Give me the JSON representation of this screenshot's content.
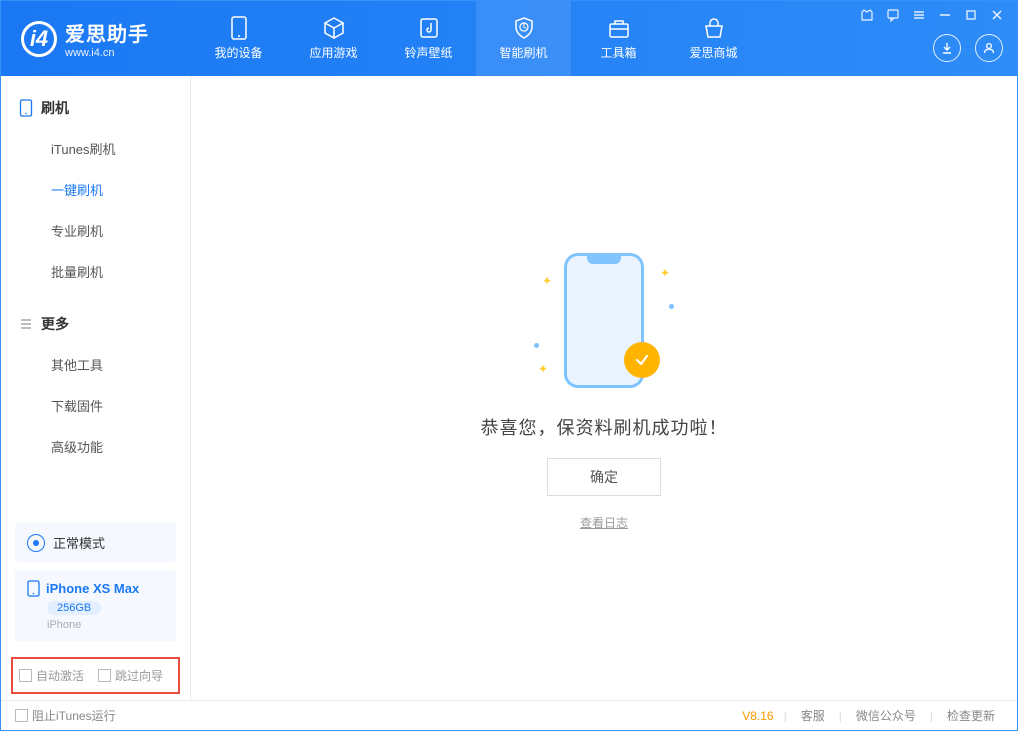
{
  "app": {
    "title": "爱思助手",
    "subtitle": "www.i4.cn"
  },
  "nav": [
    {
      "label": "我的设备",
      "icon": "phone"
    },
    {
      "label": "应用游戏",
      "icon": "cube"
    },
    {
      "label": "铃声壁纸",
      "icon": "music"
    },
    {
      "label": "智能刷机",
      "icon": "shield",
      "active": true
    },
    {
      "label": "工具箱",
      "icon": "toolbox"
    },
    {
      "label": "爱思商城",
      "icon": "store"
    }
  ],
  "sidebar": {
    "section1": {
      "title": "刷机",
      "items": [
        "iTunes刷机",
        "一键刷机",
        "专业刷机",
        "批量刷机"
      ],
      "activeIndex": 1
    },
    "section2": {
      "title": "更多",
      "items": [
        "其他工具",
        "下载固件",
        "高级功能"
      ]
    },
    "mode": "正常模式",
    "device": {
      "name": "iPhone XS Max",
      "storage": "256GB",
      "type": "iPhone"
    },
    "checkboxes": {
      "auto_activate": "自动激活",
      "skip_guide": "跳过向导"
    }
  },
  "main": {
    "success_text": "恭喜您，保资料刷机成功啦！",
    "ok_button": "确定",
    "view_log": "查看日志"
  },
  "footer": {
    "prevent_itunes": "阻止iTunes运行",
    "version": "V8.16",
    "links": [
      "客服",
      "微信公众号",
      "检查更新"
    ]
  }
}
